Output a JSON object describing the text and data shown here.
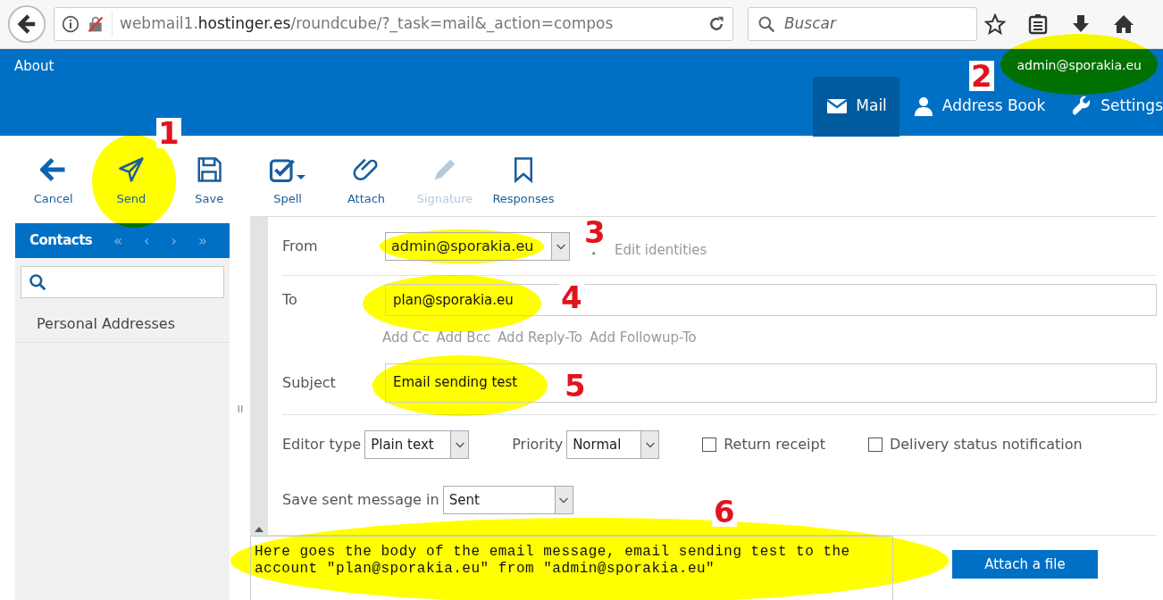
{
  "browser": {
    "url_prefix": "webmail1.",
    "url_domain": "hostinger.es",
    "url_path": "/roundcube/?_task=mail&_action=compos",
    "search": {
      "placeholder": "Buscar"
    }
  },
  "header": {
    "about": "About",
    "user": "admin@sporakia.eu",
    "nav": [
      {
        "label": "Mail",
        "selected": true
      },
      {
        "label": "Address Book",
        "selected": false
      },
      {
        "label": "Settings",
        "selected": false
      }
    ]
  },
  "toolbar": [
    {
      "label": "Cancel",
      "disabled": false
    },
    {
      "label": "Send",
      "disabled": false
    },
    {
      "label": "Save",
      "disabled": false
    }
  ],
  "compose_toolbar": [
    {
      "label": "Spell",
      "dropdown": true,
      "disabled": false
    },
    {
      "label": "Attach",
      "dropdown": false,
      "disabled": false
    },
    {
      "label": "Signature",
      "dropdown": false,
      "disabled": true
    },
    {
      "label": "Responses",
      "dropdown": false,
      "disabled": false
    }
  ],
  "contacts": {
    "title": "Contacts",
    "pager": [
      "«",
      "‹",
      "›",
      "»"
    ],
    "groups": [
      "Personal Addresses"
    ]
  },
  "form": {
    "from": {
      "label": "From",
      "value": "admin@sporakia.eu",
      "edit": "Edit identities"
    },
    "to": {
      "label": "To",
      "value": "plan@sporakia.eu"
    },
    "add_links": [
      "Add Cc",
      "Add Bcc",
      "Add Reply-To",
      "Add Followup-To"
    ],
    "subject": {
      "label": "Subject",
      "value": "Email sending test"
    },
    "editor_type": {
      "label": "Editor type",
      "value": "Plain text"
    },
    "priority": {
      "label": "Priority",
      "value": "Normal"
    },
    "checkboxes": [
      {
        "label": "Return receipt",
        "checked": false
      },
      {
        "label": "Delivery status notification",
        "checked": false
      }
    ],
    "save_sent": {
      "label": "Save sent message in",
      "value": "Sent"
    },
    "body": "Here goes the body of the email message, email sending test to the account \"plan@sporakia.eu\" from \"admin@sporakia.eu\"",
    "attach_button": "Attach a file"
  },
  "annotations": [
    "1",
    "2",
    "3",
    "4",
    "5",
    "6"
  ]
}
